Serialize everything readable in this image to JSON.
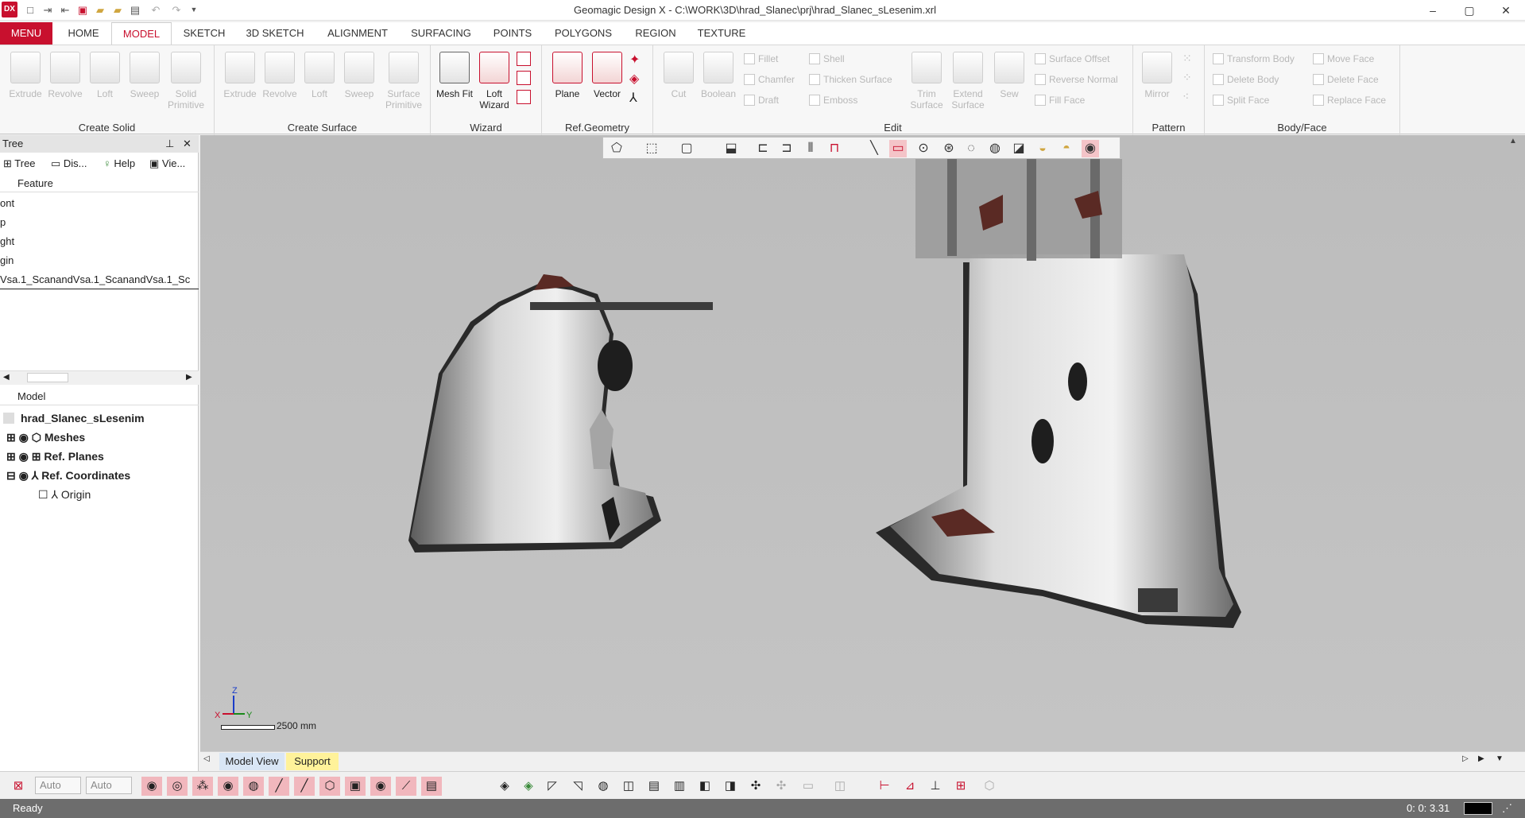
{
  "app": {
    "icon_label": "DX",
    "title": "Geomagic Design X - C:\\WORK\\3D\\hrad_Slanec\\prj\\hrad_Slanec_sLesenim.xrl"
  },
  "menu_label": "MENU",
  "tabs": [
    "HOME",
    "MODEL",
    "SKETCH",
    "3D SKETCH",
    "ALIGNMENT",
    "SURFACING",
    "POINTS",
    "POLYGONS",
    "REGION",
    "TEXTURE"
  ],
  "ribbon": {
    "create_solid": {
      "label": "Create Solid",
      "buttons": [
        "Extrude",
        "Revolve",
        "Loft",
        "Sweep",
        "Solid Primitive"
      ]
    },
    "create_surface": {
      "label": "Create Surface",
      "buttons": [
        "Extrude",
        "Revolve",
        "Loft",
        "Sweep",
        "Surface Primitive"
      ]
    },
    "wizard": {
      "label": "Wizard",
      "buttons": [
        "Mesh Fit",
        "Loft Wizard"
      ]
    },
    "refgeometry": {
      "label": "Ref.Geometry",
      "buttons": [
        "Plane",
        "Vector"
      ]
    },
    "edit": {
      "label": "Edit",
      "buttons": [
        "Cut",
        "Boolean",
        "Trim Surface",
        "Extend Surface",
        "Sew"
      ],
      "small": [
        "Fillet",
        "Chamfer",
        "Draft",
        "Shell",
        "Thicken Surface",
        "Emboss",
        "Surface Offset",
        "Reverse Normal",
        "Fill Face"
      ]
    },
    "pattern": {
      "label": "Pattern",
      "buttons": [
        "Mirror"
      ]
    },
    "bodyface": {
      "label": "Body/Face",
      "small": [
        "Transform Body",
        "Delete Body",
        "Split Face",
        "Move Face",
        "Delete Face",
        "Replace Face"
      ]
    }
  },
  "panel": {
    "title": "Tree",
    "tabs": [
      "Tree",
      "Dis...",
      "Help",
      "Vie..."
    ],
    "feature_header": "Feature",
    "features": [
      "ont",
      "p",
      "ght",
      "gin",
      "Vsa.1_ScanandVsa.1_ScanandVsa.1_Sc"
    ],
    "model_header": "Model",
    "model_root": "hrad_Slanec_sLesenim",
    "model_items": [
      "Meshes",
      "Ref. Planes",
      "Ref. Coordinates"
    ],
    "model_sub": [
      "Origin"
    ]
  },
  "viewport": {
    "scale_text": "2500 mm",
    "axis_labels": [
      "Z",
      "X",
      "Y"
    ]
  },
  "view_tabs": [
    "Model View",
    "Support"
  ],
  "combos": [
    "Auto",
    "Auto"
  ],
  "status": {
    "text": "Ready",
    "time": "0: 0: 3.31"
  }
}
